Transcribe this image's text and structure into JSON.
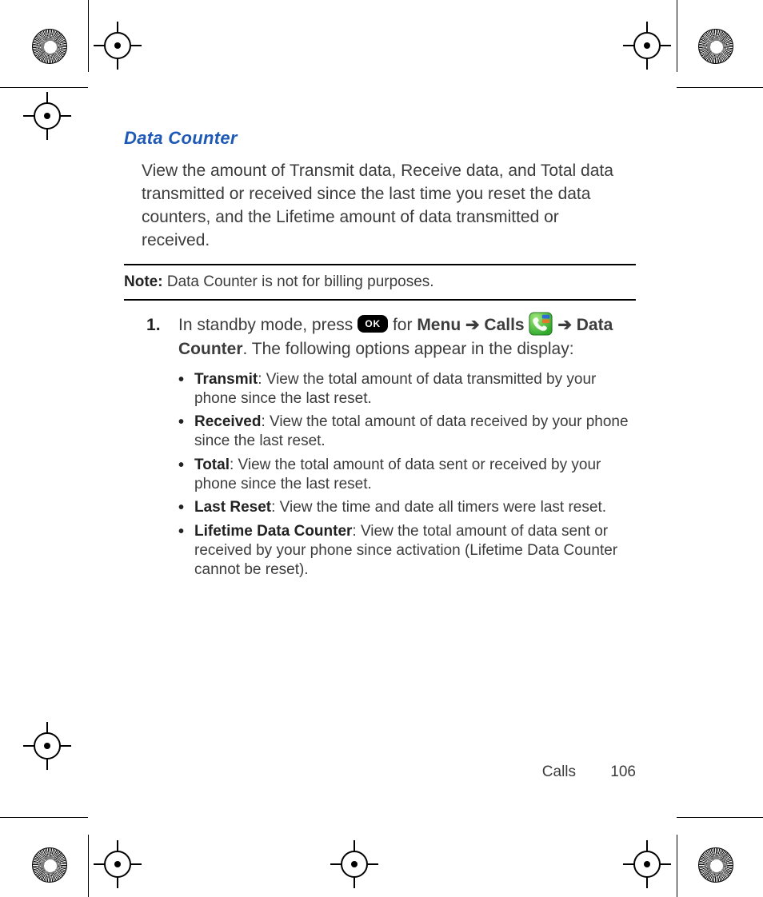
{
  "heading": "Data Counter",
  "intro": "View the amount of Transmit data, Receive data, and Total data transmitted or received since the last time you reset the data counters, and the Lifetime amount of data transmitted or received.",
  "note_label": "Note:",
  "note_text": " Data Counter is not for billing purposes.",
  "step_1": {
    "pre": "In standby mode, press ",
    "ok": "OK",
    "for": " for ",
    "menu": "Menu",
    "arrow1": " ➔ ",
    "calls": "Calls",
    "arrow2": " ➔ ",
    "datacounter": "Data Counter",
    "tail": ". The following options appear in the display:"
  },
  "bullets": [
    {
      "term": "Transmit",
      "desc": ": View the total amount of data transmitted by your phone since the last reset."
    },
    {
      "term": "Received",
      "desc": ": View the total amount of data received by your phone since the last reset."
    },
    {
      "term": "Total",
      "desc": ": View the total amount of data sent or received by your phone since the last reset."
    },
    {
      "term": "Last Reset",
      "desc": ": View the time and date all timers were last reset."
    },
    {
      "term": "Lifetime Data Counter",
      "desc": ": View the total amount of data sent or received by your phone since activation (Lifetime Data Counter cannot be reset)."
    }
  ],
  "footer_section": "Calls",
  "footer_page": "106"
}
